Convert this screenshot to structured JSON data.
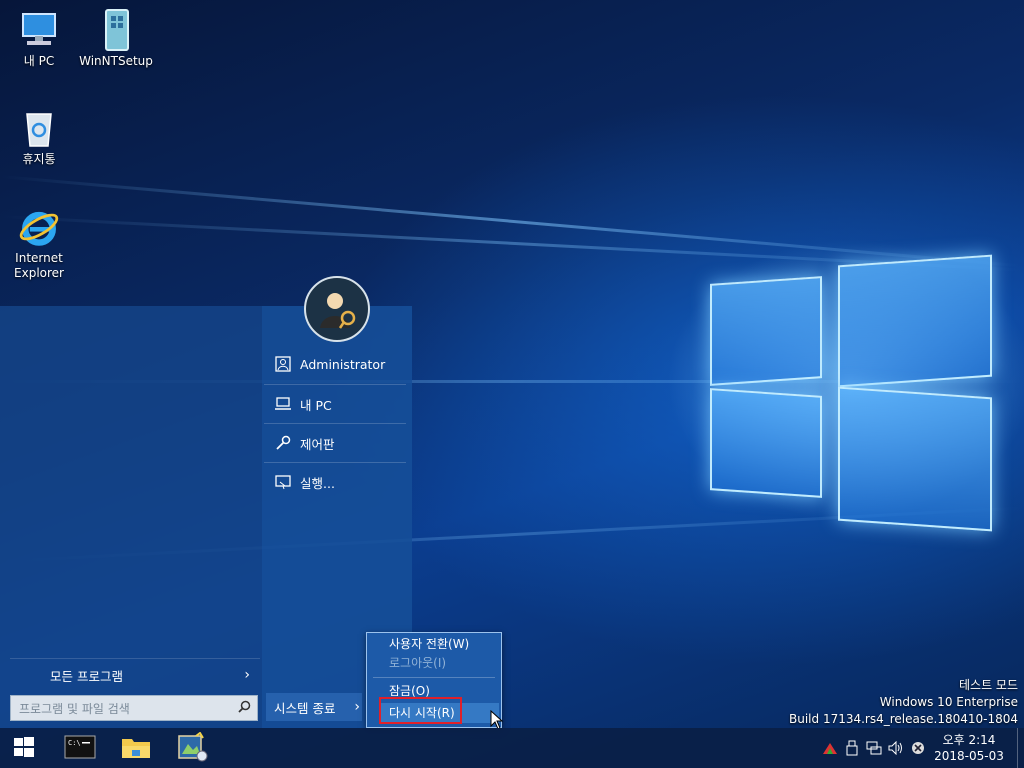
{
  "desktop": {
    "icons": [
      {
        "label": "내 PC"
      },
      {
        "label": "WinNTSetup"
      },
      {
        "label": "휴지통"
      },
      {
        "label": "Internet\nExplorer"
      }
    ]
  },
  "start_menu": {
    "items": [
      {
        "label": "Administrator",
        "icon": "user-icon"
      },
      {
        "label": "내 PC",
        "icon": "computer-icon"
      },
      {
        "label": "제어판",
        "icon": "wrench-icon"
      },
      {
        "label": "실행...",
        "icon": "run-icon"
      }
    ],
    "all_programs": "모든 프로그램",
    "search_placeholder": "프로그램 및 파일 검색",
    "shutdown_label": "시스템 종료"
  },
  "power_menu": {
    "switch_user": "사용자 전환(W)",
    "logoff": "로그아웃(I)",
    "lock": "잠금(O)",
    "restart": "다시 시작(R)"
  },
  "watermark": {
    "line1": "테스트 모드",
    "line2": "Windows 10 Enterprise",
    "line3": "Build 17134.rs4_release.180410-1804"
  },
  "taskbar": {
    "clock_time": "오후 2:14",
    "clock_date": "2018-05-03"
  },
  "colors": {
    "highlight_border": "#e0202a",
    "menu_bg": "#1d5aa8"
  }
}
